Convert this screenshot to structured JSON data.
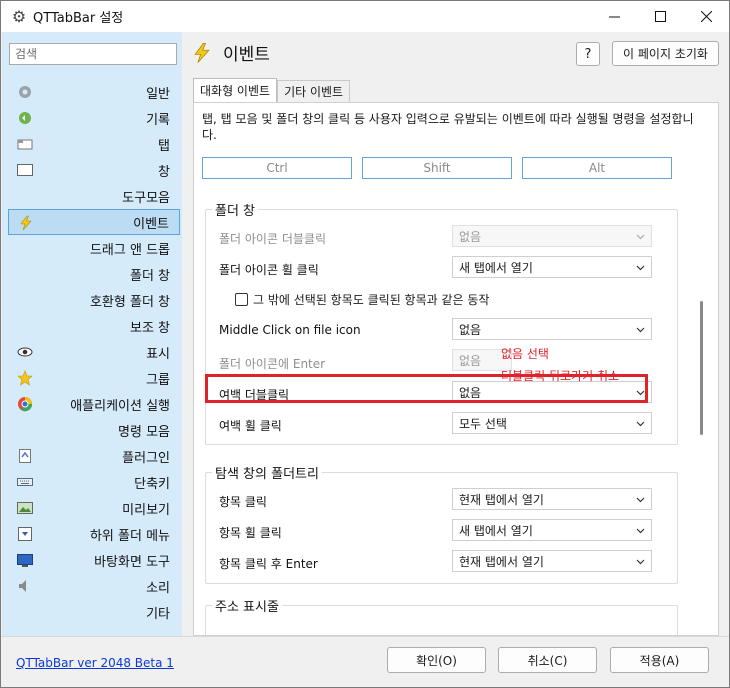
{
  "window": {
    "title": "QTTabBar 설정",
    "controls": [
      "minimize",
      "maximize",
      "close"
    ]
  },
  "sidebar": {
    "search_placeholder": "검색",
    "items": [
      {
        "label": "일반",
        "icon": "gear-icon"
      },
      {
        "label": "기록",
        "icon": "history-icon"
      },
      {
        "label": "탭",
        "icon": "tab-icon"
      },
      {
        "label": "창",
        "icon": "window-icon"
      },
      {
        "label": "도구모음",
        "icon": ""
      },
      {
        "label": "이벤트",
        "icon": "lightning-icon",
        "selected": true
      },
      {
        "label": "드래그 앤 드롭",
        "icon": ""
      },
      {
        "label": "폴더 창",
        "icon": ""
      },
      {
        "label": "호환형 폴더 창",
        "icon": ""
      },
      {
        "label": "보조 창",
        "icon": ""
      },
      {
        "label": "표시",
        "icon": "eye-icon"
      },
      {
        "label": "그룹",
        "icon": "star-icon"
      },
      {
        "label": "애플리케이션 실행",
        "icon": "app-launcher-icon"
      },
      {
        "label": "명령 모음",
        "icon": ""
      },
      {
        "label": "플러그인",
        "icon": "plugin-icon"
      },
      {
        "label": "단축키",
        "icon": "keyboard-icon"
      },
      {
        "label": "미리보기",
        "icon": "preview-icon"
      },
      {
        "label": "하위 폴더 메뉴",
        "icon": "subfolder-icon"
      },
      {
        "label": "바탕화면 도구",
        "icon": "desktop-icon"
      },
      {
        "label": "소리",
        "icon": "speaker-icon"
      },
      {
        "label": "기타",
        "icon": ""
      }
    ]
  },
  "main": {
    "title": "이벤트",
    "help_label": "?",
    "reset_label": "이 페이지 초기화",
    "tabs": [
      {
        "label": "대화형 이벤트",
        "active": true
      },
      {
        "label": "기타 이벤트",
        "active": false
      }
    ],
    "description": "탭, 탭 모음 및 폴더 창의 클릭 등 사용자 입력으로 유발되는 이벤트에 따라 실행될 명령을 설정합니다.",
    "modifiers": [
      "Ctrl",
      "Shift",
      "Alt"
    ],
    "groups": {
      "folder_window": {
        "title": "폴더 창",
        "rows": [
          {
            "label": "폴더 아이콘 더블클릭",
            "value": "없음",
            "disabled": true
          },
          {
            "label": "폴더 아이콘 휠 클릭",
            "value": "새 탭에서 열기",
            "disabled": false
          },
          {
            "label": "Middle Click on file icon",
            "value": "없음",
            "disabled": false
          },
          {
            "label": "폴더 아이콘에 Enter",
            "value": "없음",
            "disabled": true
          },
          {
            "label": "여백 더블클릭",
            "value": "없음",
            "disabled": false
          },
          {
            "label": "여백 휠 클릭",
            "value": "모두 선택",
            "disabled": false
          }
        ],
        "checkbox_label": "그 밖에 선택된 항목도 클릭된 항목과 같은 동작",
        "checkbox_checked": false
      },
      "explorer_tree": {
        "title": "탐색 창의 폴더트리",
        "rows": [
          {
            "label": "항목 클릭",
            "value": "현재 탭에서 열기"
          },
          {
            "label": "항목 휠 클릭",
            "value": "새 탭에서 열기"
          },
          {
            "label": "항목 클릭 후 Enter",
            "value": "현재 탭에서 열기"
          }
        ]
      },
      "address_bar": {
        "title": "주소 표시줄"
      }
    },
    "annotation": {
      "line1": "없음 선택",
      "line2": "더블클릭 뒤로가기 취소",
      "color": "#e0222a"
    }
  },
  "footer": {
    "version_link": "QTTabBar ver 2048 Beta 1",
    "ok_label": "확인(O)",
    "cancel_label": "취소(C)",
    "apply_label": "적용(A)"
  }
}
